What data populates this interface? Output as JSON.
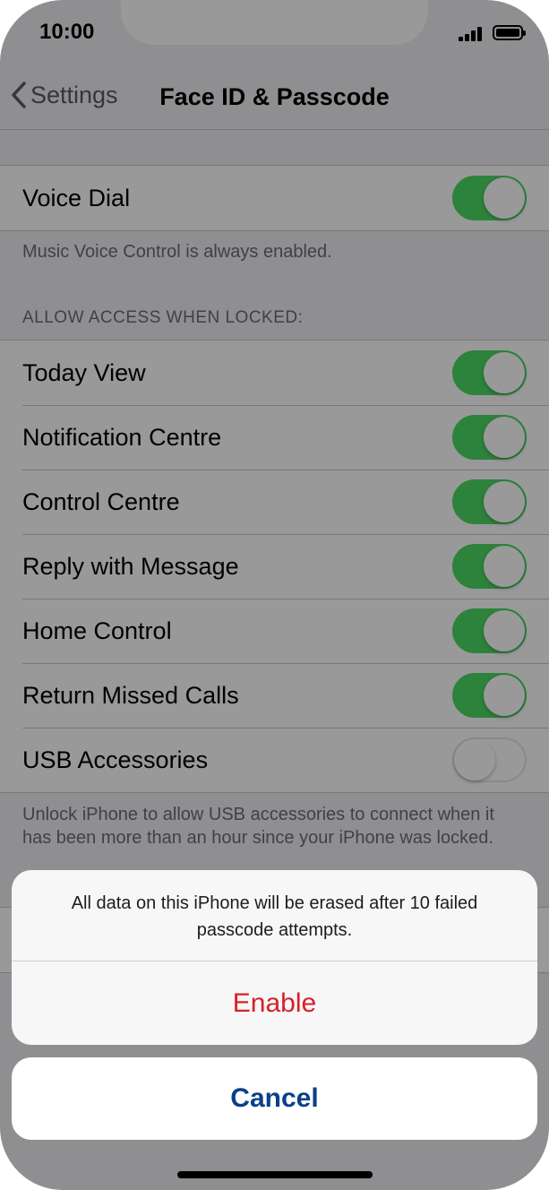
{
  "status_bar": {
    "time": "10:00"
  },
  "nav": {
    "back_label": "Settings",
    "title": "Face ID & Passcode"
  },
  "voice_dial": {
    "label": "Voice Dial",
    "on": true,
    "footer": "Music Voice Control is always enabled."
  },
  "locked_section": {
    "header": "ALLOW ACCESS WHEN LOCKED:",
    "items": [
      {
        "label": "Today View",
        "on": true
      },
      {
        "label": "Notification Centre",
        "on": true
      },
      {
        "label": "Control Centre",
        "on": true
      },
      {
        "label": "Reply with Message",
        "on": true
      },
      {
        "label": "Home Control",
        "on": true
      },
      {
        "label": "Return Missed Calls",
        "on": true
      },
      {
        "label": "USB Accessories",
        "on": false
      }
    ],
    "footer": "Unlock iPhone to allow USB accessories to connect when it has been more than an hour since your iPhone was locked."
  },
  "action_sheet": {
    "message": "All data on this iPhone will be erased after 10 failed passcode attempts.",
    "enable_label": "Enable",
    "cancel_label": "Cancel"
  },
  "colors": {
    "toggle_on": "#4cd964",
    "destructive": "#d81f2a",
    "cancel_text": "#0a3f8a"
  }
}
